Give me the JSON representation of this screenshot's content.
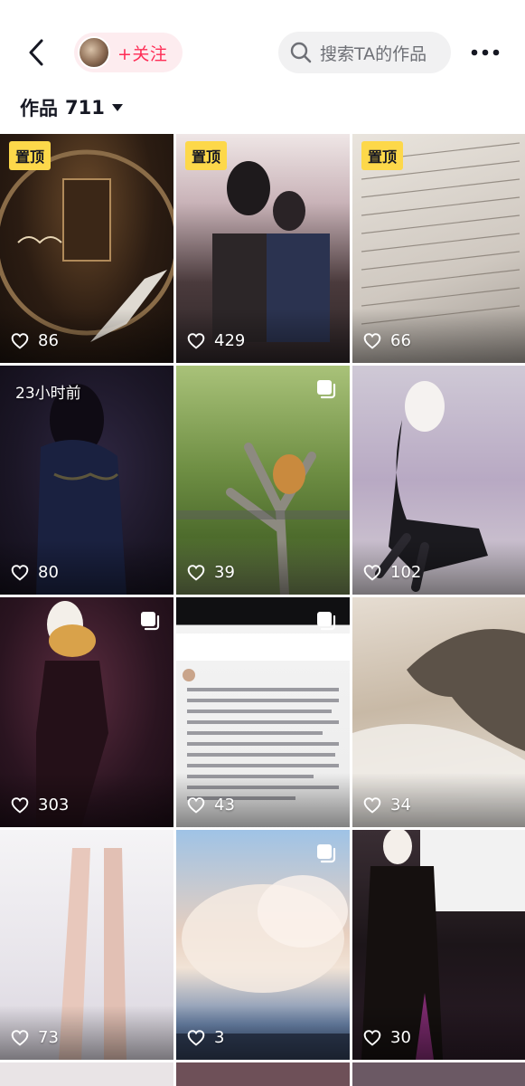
{
  "header": {
    "follow_label": "+关注",
    "search_placeholder": "搜索TA的作品"
  },
  "works": {
    "label": "作品",
    "count": "711"
  },
  "tiles": [
    {
      "likes": "86",
      "badge": "置顶",
      "multi": false
    },
    {
      "likes": "429",
      "badge": "置顶",
      "multi": false
    },
    {
      "likes": "66",
      "badge": "置顶",
      "multi": false
    },
    {
      "likes": "80",
      "time": "23小时前",
      "multi": false
    },
    {
      "likes": "39",
      "multi": true
    },
    {
      "likes": "102",
      "multi": false
    },
    {
      "likes": "303",
      "multi": true
    },
    {
      "likes": "43",
      "multi": true
    },
    {
      "likes": "34",
      "multi": false
    },
    {
      "likes": "73",
      "multi": false
    },
    {
      "likes": "3",
      "multi": true
    },
    {
      "likes": "30",
      "multi": false
    }
  ],
  "colors": {
    "accent": "#fe2c55",
    "pin_badge": "#fdd84a"
  },
  "icons": [
    "back-arrow-icon",
    "search-icon",
    "more-dots-icon",
    "caret-down-icon",
    "heart-icon",
    "multi-image-icon"
  ]
}
